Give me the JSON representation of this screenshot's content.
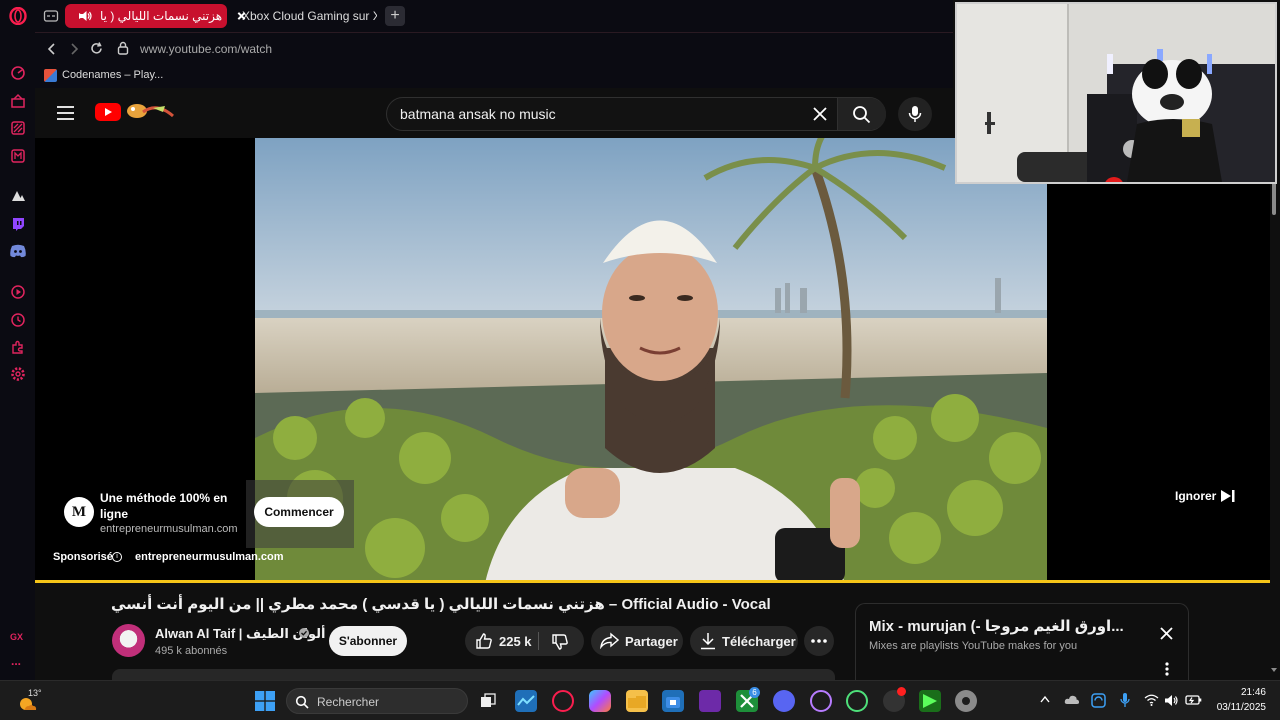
{
  "browser": {
    "tabs": [
      {
        "title": "هزتني نسمات الليالي ( يا",
        "active": true
      },
      {
        "title": "Xbox Cloud Gaming sur X",
        "active": false
      }
    ],
    "new_tab": "+",
    "url": "www.youtube.com/watch",
    "bookmark": "Codenames – Play..."
  },
  "sidebar": {
    "icons": [
      "opera-logo-icon",
      "tab-islands-icon",
      "aria-icon",
      "gx-corner-icon",
      "messenger-icon",
      "ai-icon",
      "twitch-icon",
      "discord-icon",
      "player-icon",
      "history-icon",
      "extensions-icon",
      "settings-icon",
      "more-icon"
    ],
    "gx_label": "GX",
    "more_label": "..."
  },
  "youtube": {
    "search_query": "batmana ansak no music",
    "ad": {
      "title": "Une méthode 100% en ligne",
      "domain": "entrepreneurmusulman.com",
      "cta": "Commencer",
      "sponsored": "Sponsorisé",
      "sponsored_domain": "entrepreneurmusulman.com",
      "skip": "Ignorer",
      "logo_letter": "M"
    },
    "video": {
      "title": "هزتني نسمات الليالي ( يا قدسي ) محمد مطري || من اليوم أنت أنسي – Official Audio - Vocal",
      "channel": "Alwan Al Taif | ألوان الطيف",
      "subscribers": "495 k abonnés",
      "subscribe_label": "S'abonner",
      "likes": "225 k",
      "share_label": "Partager",
      "download_label": "Télécharger",
      "progress_fraction": 1.0
    },
    "mix": {
      "title": "Mix - murujan (- ‎اورق الغيم مروجا...",
      "subtitle": "Mixes are playlists YouTube makes for you"
    }
  },
  "taskbar": {
    "weather_temp": "13°",
    "search_placeholder": "Rechercher",
    "time": "21:46",
    "date": "03/11/2025",
    "store_badge": "6"
  },
  "colors": {
    "opera_red": "#fa1e4e",
    "youtube_red": "#ff0000",
    "progress_yellow": "#f5c518",
    "tab_active_bg": "#c8102e"
  }
}
